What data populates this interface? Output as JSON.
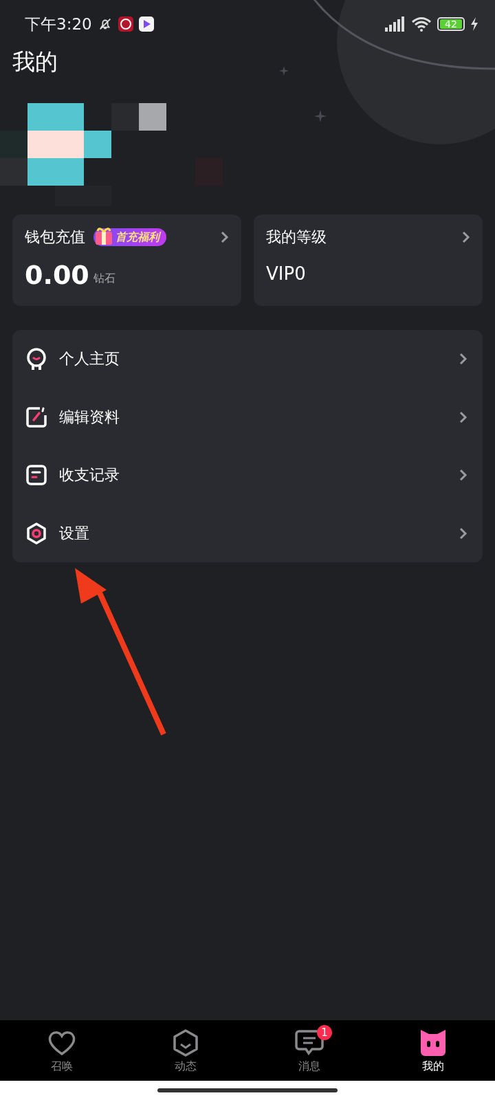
{
  "status_bar": {
    "time": "下午3:20",
    "battery": "42"
  },
  "title": "我的",
  "cards": [
    {
      "kind": "wallet",
      "title": "钱包充值",
      "badge": "首充福利",
      "value": "0.00",
      "unit": "钻石"
    },
    {
      "kind": "level",
      "title": "我的等级",
      "value": "VIP0"
    }
  ],
  "menu": [
    {
      "kind": "profile",
      "label": "个人主页"
    },
    {
      "kind": "edit",
      "label": "编辑资料"
    },
    {
      "kind": "records",
      "label": "收支记录"
    },
    {
      "kind": "settings",
      "label": "设置"
    }
  ],
  "tab_bar": [
    {
      "kind": "heart",
      "label": "召唤",
      "selected": false
    },
    {
      "kind": "hexagon",
      "label": "动态",
      "selected": false
    },
    {
      "kind": "chat",
      "label": "消息",
      "selected": false,
      "badge": "1"
    },
    {
      "kind": "cat",
      "label": "我的",
      "selected": true
    }
  ]
}
